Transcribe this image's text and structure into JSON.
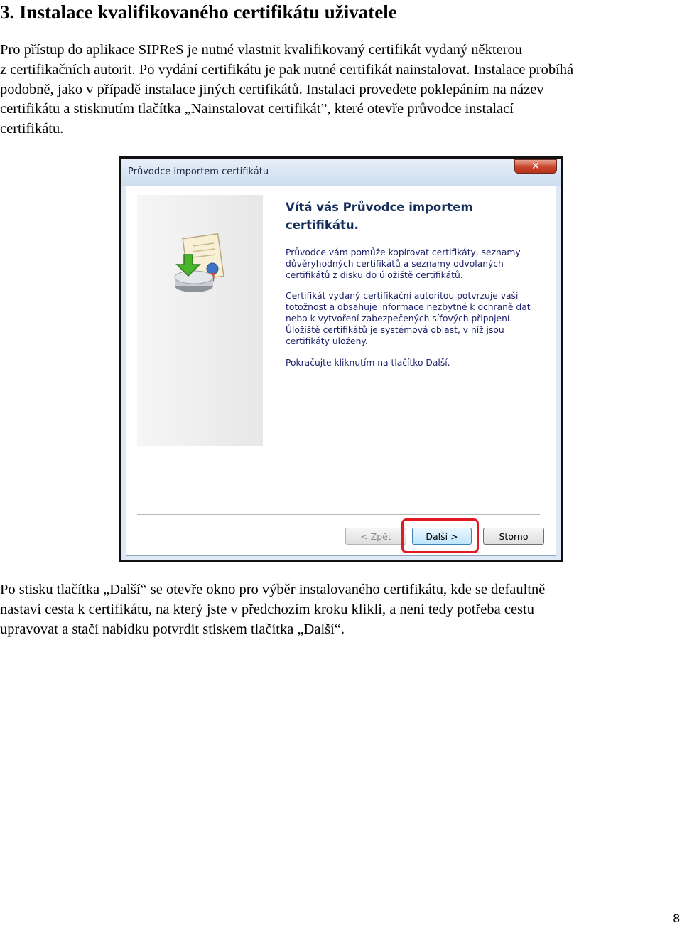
{
  "heading": "3. Instalace kvalifikovaného certifikátu uživatele",
  "intro_lines": [
    "Pro přístup do aplikace SIPReS je nutné vlastnit kvalifikovaný certifikát vydaný některou",
    "z certifikačních autorit. Po vydání certifikátu je pak nutné certifikát nainstalovat. Instalace probíhá",
    "podobně, jako v případě instalace jiných certifikátů. Instalaci provedete poklepáním na název",
    "certifikátu a stisknutím tlačítka „Nainstalovat certifikát”, které otevře průvodce instalací",
    "certifikátu."
  ],
  "dialog": {
    "title": "Průvodce importem certifikátu",
    "close_glyph": "✕",
    "welcome_title_lines": [
      "Vítá vás Průvodce importem",
      "certifikátu."
    ],
    "para1_lines": [
      "Průvodce vám pomůže kopírovat certifikáty, seznamy",
      "důvěryhodných certifikátů a seznamy odvolaných",
      "certifikátů z disku do úložiště certifikátů."
    ],
    "para2_lines": [
      "Certifikát vydaný certifikační autoritou potvrzuje vaši",
      "totožnost a obsahuje informace nezbytné k ochraně dat",
      "nebo k vytvoření zabezpečených síťových připojení.",
      "Úložiště certifikátů je systémová oblast, v níž jsou",
      "certifikáty uloženy."
    ],
    "para3_lines": [
      "Pokračujte kliknutím na tlačítko Další."
    ],
    "buttons": {
      "back": "< Zpět",
      "next": "Další >",
      "cancel": "Storno"
    },
    "icon": "certificate-import-icon",
    "highlight_color": "#e21b23"
  },
  "outro_lines": [
    "Po stisku tlačítka „Další“ se otevře okno pro výběr instalovaného certifikátu, kde se defaultně",
    "nastaví cesta k certifikátu, na který jste v předchozím kroku klikli, a není tedy potřeba cestu",
    "upravovat a stačí nabídku potvrdit stiskem tlačítka „Další“."
  ],
  "page_number": "8"
}
